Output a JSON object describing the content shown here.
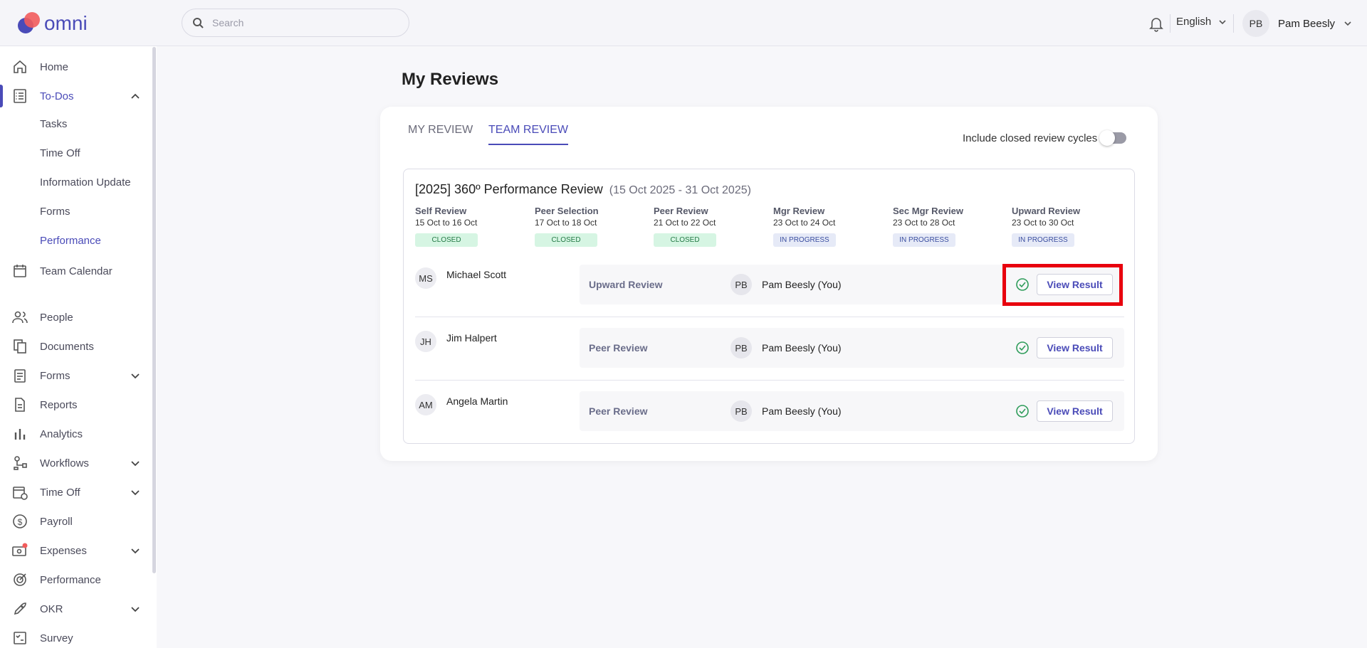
{
  "app": {
    "logo_text": "omni"
  },
  "topbar": {
    "search_placeholder": "Search",
    "language": "English",
    "user_initials": "PB",
    "user_name": "Pam Beesly"
  },
  "sidebar": {
    "items": [
      {
        "label": "Home",
        "icon": "home-icon"
      },
      {
        "label": "To-Dos",
        "icon": "checklist-icon"
      },
      {
        "label": "Team Calendar",
        "icon": "calendar-icon"
      },
      {
        "label": "People",
        "icon": "people-icon"
      },
      {
        "label": "Documents",
        "icon": "documents-icon"
      },
      {
        "label": "Forms",
        "icon": "forms-icon"
      },
      {
        "label": "Reports",
        "icon": "report-icon"
      },
      {
        "label": "Analytics",
        "icon": "bar-chart-icon"
      },
      {
        "label": "Workflows",
        "icon": "workflow-icon"
      },
      {
        "label": "Time Off",
        "icon": "calendar-timeoff-icon"
      },
      {
        "label": "Payroll",
        "icon": "dollar-icon"
      },
      {
        "label": "Expenses",
        "icon": "wallet-icon"
      },
      {
        "label": "Performance",
        "icon": "target-icon"
      },
      {
        "label": "OKR",
        "icon": "rocket-icon"
      },
      {
        "label": "Survey",
        "icon": "survey-icon"
      }
    ],
    "todo_subitems": [
      "Tasks",
      "Time Off",
      "Information Update",
      "Forms",
      "Performance"
    ]
  },
  "main": {
    "title": "My Reviews",
    "tabs": [
      "MY REVIEW",
      "TEAM REVIEW"
    ],
    "toggle_label": "Include closed review cycles",
    "cycle": {
      "title": "[2025] 360º Performance Review",
      "range": "(15 Oct 2025 - 31 Oct 2025)",
      "phases": [
        {
          "name": "Self Review",
          "dates": "15 Oct to 16 Oct",
          "status": "CLOSED"
        },
        {
          "name": "Peer Selection",
          "dates": "17 Oct to 18 Oct",
          "status": "CLOSED"
        },
        {
          "name": "Peer Review",
          "dates": "21 Oct to 22 Oct",
          "status": "CLOSED"
        },
        {
          "name": "Mgr Review",
          "dates": "23 Oct to 24 Oct",
          "status": "IN PROGRESS"
        },
        {
          "name": "Sec Mgr Review",
          "dates": "23 Oct to 28 Oct",
          "status": "IN PROGRESS"
        },
        {
          "name": "Upward Review",
          "dates": "23 Oct to 30 Oct",
          "status": "IN PROGRESS"
        }
      ],
      "rows": [
        {
          "initials": "MS",
          "name": "Michael Scott",
          "review_type": "Upward Review",
          "reviewer_initials": "PB",
          "reviewer": "Pam Beesly (You)",
          "action": "View Result"
        },
        {
          "initials": "JH",
          "name": "Jim Halpert",
          "review_type": "Peer Review",
          "reviewer_initials": "PB",
          "reviewer": "Pam Beesly (You)",
          "action": "View Result"
        },
        {
          "initials": "AM",
          "name": "Angela Martin",
          "review_type": "Peer Review",
          "reviewer_initials": "PB",
          "reviewer": "Pam Beesly (You)",
          "action": "View Result"
        }
      ]
    }
  },
  "colors": {
    "accent": "#4a4bb8",
    "highlight": "#e8000d",
    "success": "#2e9c5a"
  }
}
